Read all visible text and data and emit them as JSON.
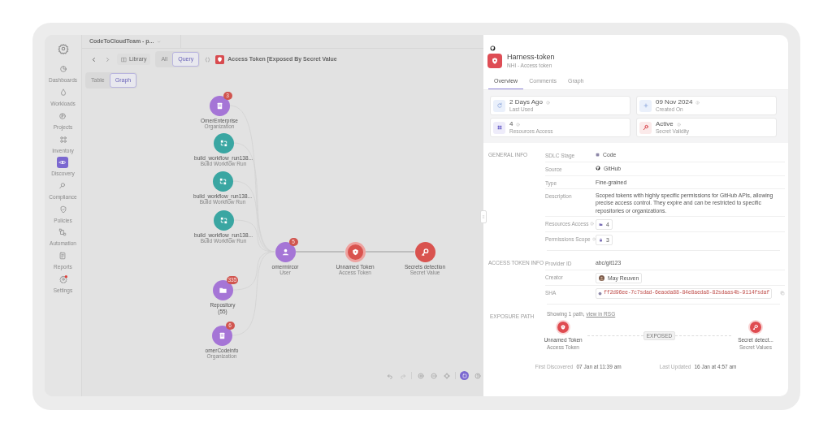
{
  "workspace": {
    "name": "CodeToCloudTeam - p..."
  },
  "sidebar": {
    "items": [
      {
        "label": "Dashboards",
        "selected": false,
        "alert": false
      },
      {
        "label": "Workloads",
        "selected": false,
        "alert": false
      },
      {
        "label": "Projects",
        "selected": false,
        "alert": false
      },
      {
        "label": "Inventory",
        "selected": false,
        "alert": false
      },
      {
        "label": "Discovery",
        "selected": true,
        "alert": false
      },
      {
        "label": "Compliance",
        "selected": false,
        "alert": false
      },
      {
        "label": "Policies",
        "selected": false,
        "alert": false
      },
      {
        "label": "Automation",
        "selected": false,
        "alert": false
      },
      {
        "label": "Reports",
        "selected": false,
        "alert": false
      },
      {
        "label": "Settings",
        "selected": false,
        "alert": true
      }
    ]
  },
  "toolbar": {
    "library": "Library",
    "modes": [
      {
        "label": "All",
        "selected": false
      },
      {
        "label": "Query",
        "selected": true
      }
    ],
    "query": "Access Token [Exposed By Secret Value"
  },
  "views": [
    {
      "label": "Table",
      "selected": false
    },
    {
      "label": "Graph",
      "selected": true
    }
  ],
  "graph": {
    "nodes": [
      {
        "name": "OmerEnterprise",
        "type": "Organization",
        "kind": "organization",
        "badge": "3",
        "selected": false
      },
      {
        "name": "build_workflow_run138...",
        "type": "Build Workflow Run",
        "kind": "workflow",
        "selected": false
      },
      {
        "name": "build_workflow_run138...",
        "type": "Build Workflow Run",
        "kind": "workflow",
        "selected": false
      },
      {
        "name": "build_workflow_run138...",
        "type": "Build Workflow Run",
        "kind": "workflow",
        "selected": false
      },
      {
        "name": "omermircor",
        "type": "User",
        "kind": "user",
        "badge": "5",
        "selected": false
      },
      {
        "name": "Unnamed Token",
        "type": "Access Token",
        "kind": "token",
        "selected": true
      },
      {
        "name": "Secrets detection",
        "type": "Secret Value",
        "kind": "secret",
        "selected": false
      },
      {
        "name": "Repository",
        "count": "(55)",
        "kind": "repository",
        "badge": "335",
        "selected": false
      },
      {
        "name": "omerCodeinfo",
        "type": "Organization",
        "kind": "organization",
        "badge": "6",
        "selected": false
      }
    ]
  },
  "canvas_tools": [
    {
      "selected": false
    },
    {
      "selected": false
    },
    {
      "selected": false
    },
    {
      "selected": false
    },
    {
      "selected": false
    },
    {
      "selected": true
    },
    {
      "selected": false
    }
  ],
  "detail": {
    "title": "Harness-token",
    "subtitle": "NHI - Access token",
    "tabs": [
      {
        "label": "Overview",
        "selected": true
      },
      {
        "label": "Comments",
        "selected": false
      },
      {
        "label": "Graph",
        "selected": false
      }
    ],
    "stats": [
      {
        "value": "2 Days Ago",
        "label": "Last Used"
      },
      {
        "value": "09 Nov 2024",
        "label": "Created On"
      },
      {
        "value": "4",
        "label": "Resources Access"
      },
      {
        "value": "Active",
        "label": "Secret Validity"
      }
    ],
    "sections": [
      {
        "title": "GENERAL INFO",
        "rows": [
          {
            "label": "SDLC Stage",
            "value": "Code",
            "kind": "stage",
            "info": false
          },
          {
            "label": "Source",
            "value": "GitHub",
            "kind": "source",
            "info": false
          },
          {
            "label": "Type",
            "value": "Fine-grained",
            "kind": "text",
            "info": false
          },
          {
            "label": "Description",
            "value": "Scoped tokens with highly specific permissions for GitHub APIs, allowing precise access control. They expire and can be restricted to specific repositories or organizations.",
            "kind": "text",
            "info": false
          },
          {
            "label": "Resources Access",
            "value": "4",
            "kind": "folder-chip",
            "info": true
          },
          {
            "label": "Permissions Scope",
            "value": "3",
            "kind": "lock-chip",
            "info": true
          }
        ]
      },
      {
        "title": "ACCESS TOKEN INFO",
        "rows": [
          {
            "label": "Provider ID",
            "value": "abc/git123",
            "kind": "text",
            "info": false
          },
          {
            "label": "Creator",
            "value": "May Reuven",
            "kind": "person",
            "info": false
          },
          {
            "label": "SHA",
            "value": "ff2d96ee-7c7sdad-6eaoda88-84e8aeda8-82sdaas4b-9114fsdaf",
            "kind": "sha",
            "info": false
          }
        ]
      }
    ],
    "exposure": {
      "title": "EXPOSURE PATH",
      "summary": "Showing 1 path,",
      "link": "view in RSG",
      "from": {
        "name": "Unnamed Token",
        "type": "Access Token",
        "kind": "token"
      },
      "edge": "EXPOSED",
      "to": {
        "name": "Secret detect...",
        "type": "Secret Values",
        "kind": "secret"
      }
    },
    "footer": [
      {
        "label": "First Discovered",
        "value": "07 Jan at 11:39 am"
      },
      {
        "label": "Last Updated",
        "value": "16 Jan at 4:57 am"
      }
    ]
  }
}
